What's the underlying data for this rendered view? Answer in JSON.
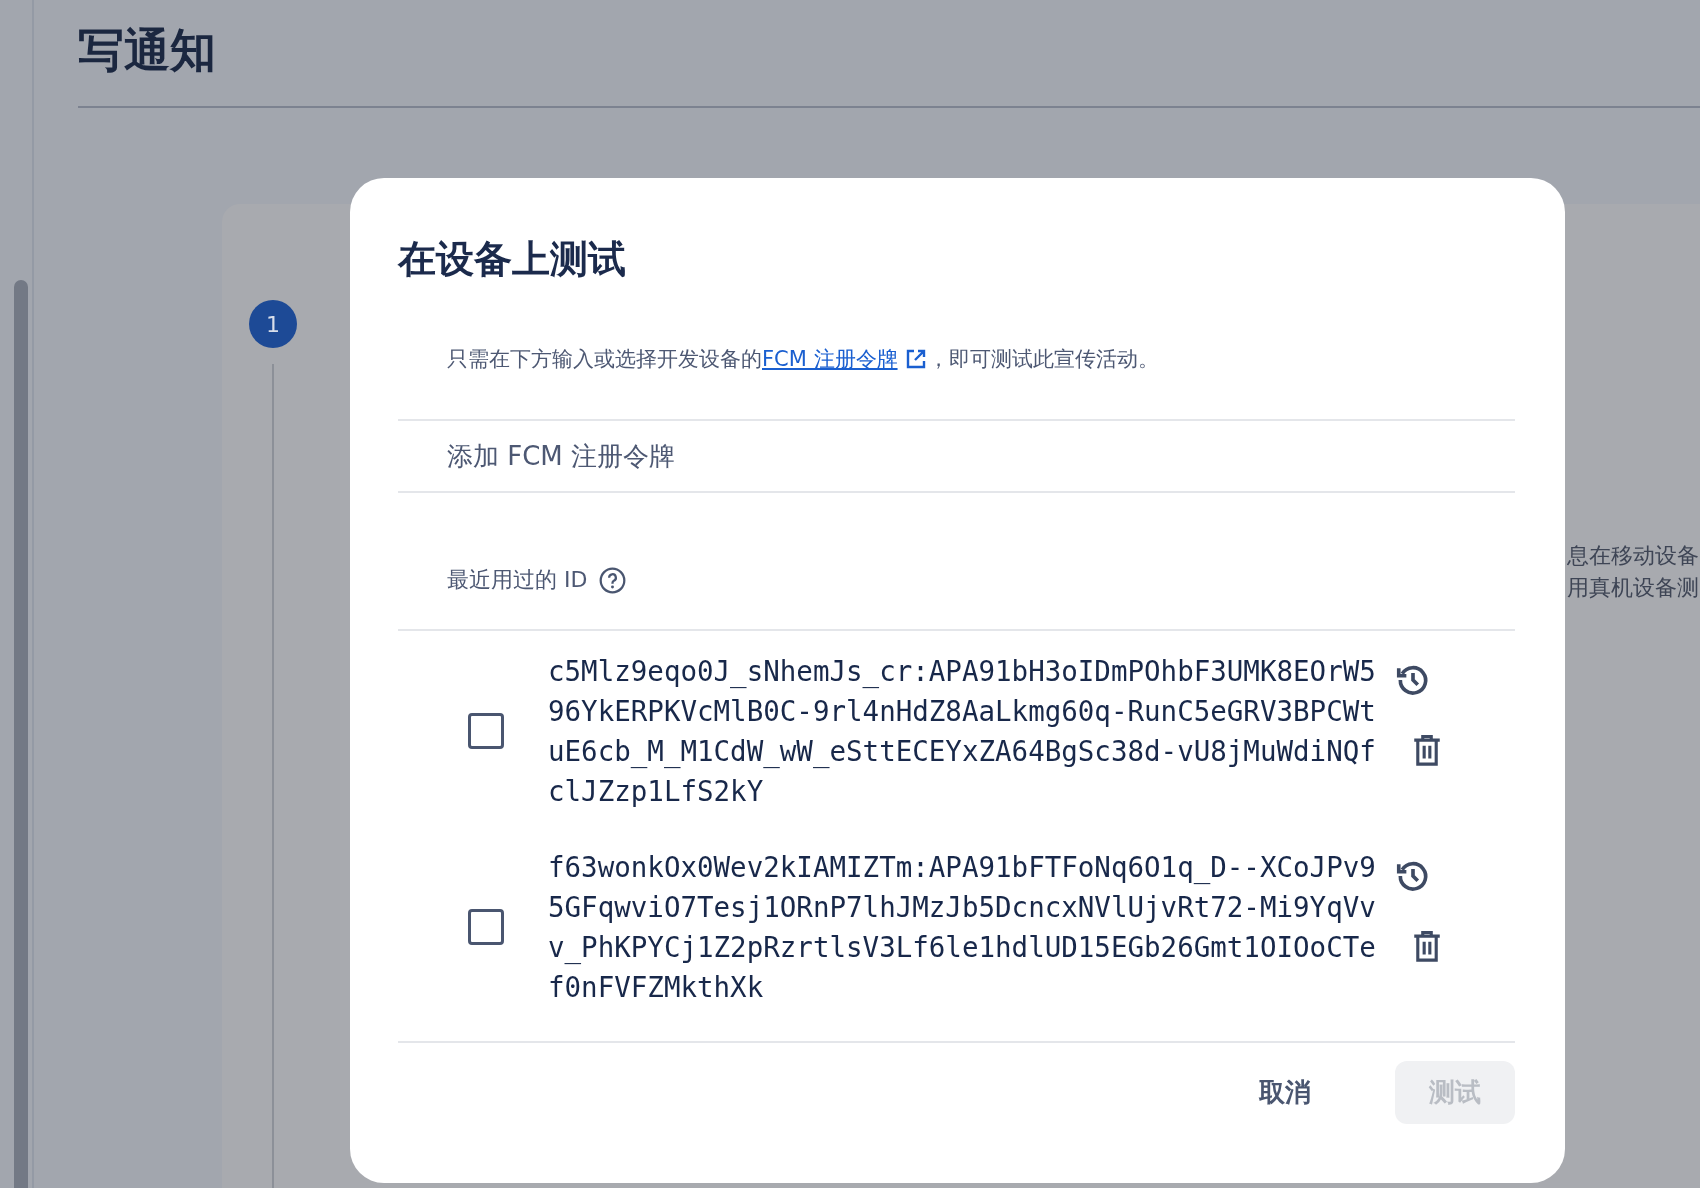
{
  "page": {
    "title": "写通知",
    "step_number": "1",
    "side_text": [
      "息在移动设备",
      "用真机设备测"
    ]
  },
  "dialog": {
    "title": "在设备上测试",
    "description": {
      "before": "只需在下方输入或选择开发设备的",
      "link": "FCM 注册令牌",
      "after": "，即可测试此宣传活动。"
    },
    "token_input": {
      "placeholder": "添加 FCM 注册令牌"
    },
    "recent_label": "最近用过的 ID",
    "recent_ids": [
      {
        "token": "c5Mlz9eqo0J_sNhemJs_cr:APA91bH3oIDmPOhbF3UMK8EOrW596YkERPKVcMlB0C-9rl4nHdZ8AaLkmg60q-RunC5eGRV3BPCWtuE6cb_M_M1CdW_wW_eSttECEYxZA64BgSc38d-vU8jMuWdiNQfclJZzp1LfS2kY",
        "checked": false
      },
      {
        "token": "f63wonkOx0Wev2kIAMIZTm:APA91bFTFoNq6O1q_D--XCoJPv95GFqwviO7Tesj1ORnP7lhJMzJb5DcncxNVlUjvRt72-Mi9YqVvv_PhKPYCj1Z2pRzrtlsV3Lf6le1hdlUD15EGb26Gmt1OIOoCTef0nFVFZMkthXk",
        "checked": false
      }
    ],
    "buttons": [
      {
        "label": "取消",
        "kind": "text",
        "disabled": false
      },
      {
        "label": "测试",
        "kind": "filled",
        "disabled": true
      }
    ]
  }
}
